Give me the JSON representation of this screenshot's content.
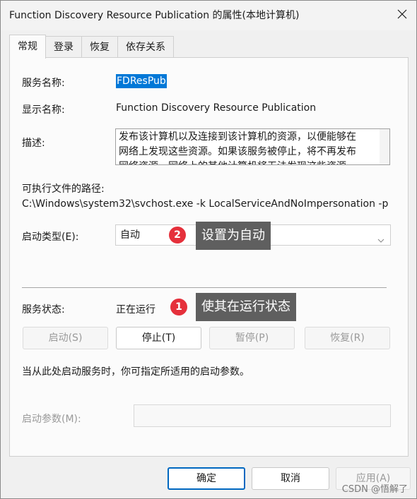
{
  "window": {
    "title": "Function Discovery Resource Publication 的属性(本地计算机)"
  },
  "tabs": [
    {
      "label": "常规",
      "active": true
    },
    {
      "label": "登录",
      "active": false
    },
    {
      "label": "恢复",
      "active": false
    },
    {
      "label": "依存关系",
      "active": false
    }
  ],
  "general": {
    "service_name_label": "服务名称:",
    "service_name_value": "FDResPub",
    "display_name_label": "显示名称:",
    "display_name_value": "Function Discovery Resource Publication",
    "description_label": "描述:",
    "description_lines": [
      "发布该计算机以及连接到该计算机的资源，以便能够在",
      "网络上发现这些资源。如果该服务被停止，将不再发布",
      "网络资源，网络上的其他计算机将无法发现这些资源"
    ],
    "exe_path_label": "可执行文件的路径:",
    "exe_path_value": "C:\\Windows\\system32\\svchost.exe -k LocalServiceAndNoImpersonation -p",
    "startup_type_label": "启动类型(E):",
    "startup_type_value": "自动",
    "service_status_label": "服务状态:",
    "service_status_value": "正在运行",
    "buttons": {
      "start": "启动(S)",
      "stop": "停止(T)",
      "pause": "暂停(P)",
      "resume": "恢复(R)"
    },
    "hint_text": "当从此处启动服务时，你可指定所适用的启动参数。",
    "start_params_label": "启动参数(M):",
    "start_params_value": ""
  },
  "dialog_buttons": {
    "ok": "确定",
    "cancel": "取消",
    "apply": "应用(A)"
  },
  "annotations": [
    {
      "number": "1",
      "text": "使其在运行状态"
    },
    {
      "number": "2",
      "text": "设置为自动"
    }
  ],
  "watermark": "CSDN @悟解了",
  "colors": {
    "selection": "#0078d7",
    "badge": "#e5303b",
    "callout_bg": "#5f5f5f",
    "primary_border": "#0067c0"
  },
  "icons": {
    "close": "close-icon",
    "dropdown": "chevron-down-icon"
  }
}
